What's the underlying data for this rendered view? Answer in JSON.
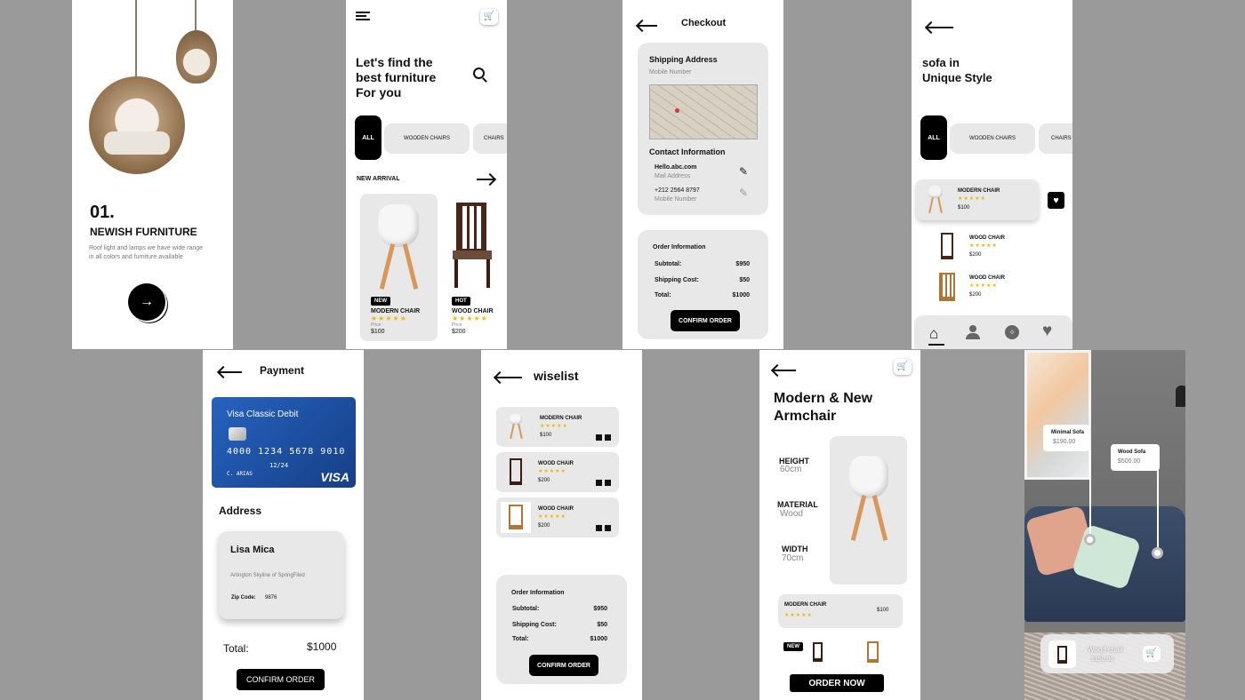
{
  "s1": {
    "num": "01.",
    "title": "NEWISH FURNITURE",
    "desc_line1": "Roof light and lamps we have  wide range",
    "desc_line2": "in all colors and furniture available"
  },
  "s2": {
    "heading_line1": "Let's find the",
    "heading_line2": "best furniture",
    "heading_line3": "For you",
    "tabs": [
      "ALL",
      "WOODEN CHAIRS",
      "CHAIRS"
    ],
    "section": "NEW ARRIVAL",
    "cards": [
      {
        "tag": "NEW",
        "name": "MODERN CHAIR",
        "stars": "★★★★★",
        "price_label": "Price",
        "price": "$100"
      },
      {
        "tag": "HOT",
        "name": "WOOD CHAIR",
        "stars": "★★★★★",
        "price_label": "Price",
        "price": "$200"
      }
    ]
  },
  "s3": {
    "title": "Checkout",
    "ship_title": "Shipping Address",
    "ship_sub": "Mobile Number",
    "contact_title": "Contact Information",
    "email": "Hello.abc.com",
    "email_label": "Mail Address",
    "phone": "+212    2564   8797",
    "phone_label": "Mobile Number",
    "order_title": "Order Information",
    "rows": [
      {
        "k": "Subtotal:",
        "v": "$950"
      },
      {
        "k": "Shipping Cost:",
        "v": "$50"
      },
      {
        "k": "Total:",
        "v": "$1000"
      }
    ],
    "confirm": "CONFIRM ORDER"
  },
  "s4": {
    "heading_line1": "sofa in",
    "heading_line2": "Unique Style",
    "tabs": [
      "ALL",
      "WOODEN CHAIRS",
      "CHAIRS"
    ],
    "items": [
      {
        "name": "MODERN CHAIR",
        "stars": "★★★★★",
        "price": "$100"
      },
      {
        "name": "WOOD CHAIR",
        "stars": "★★★★★",
        "price": "$200"
      },
      {
        "name": "WOOD CHAIR",
        "stars": "★★★★★",
        "price": "$200"
      }
    ]
  },
  "s5": {
    "title": "Payment",
    "card_name": "Visa Classic Debit",
    "card_number": "4000  1234  5678  9010",
    "card_exp": "12/24",
    "card_holder": "C. ARIAS",
    "card_brand": "VISA",
    "address_title": "Address",
    "person": "Lisa Mica",
    "addr": "Artington Skyline of SpringFiled",
    "zip_label": "Zip Code:",
    "zip": "9876",
    "total_label": "Total:",
    "total": "$1000",
    "confirm": "CONFIRM ORDER"
  },
  "s6": {
    "title": "wiselist",
    "items": [
      {
        "name": "MODERN CHAIR",
        "stars": "★★★★★",
        "price": "$100"
      },
      {
        "name": "WOOD CHAIR",
        "stars": "★★★★★",
        "price": "$200"
      },
      {
        "name": "WOOD CHAIR",
        "stars": "★★★★★",
        "price": "$200"
      }
    ],
    "order_title": "Order Information",
    "rows": [
      {
        "k": "Subtotal:",
        "v": "$950"
      },
      {
        "k": "Shipping Cost:",
        "v": "$50"
      },
      {
        "k": "Total:",
        "v": "$1000"
      }
    ],
    "confirm": "CONFIRM ORDER"
  },
  "s7": {
    "heading_line1": "Modern & New",
    "heading_line2": "Armchair",
    "specs": [
      {
        "k": "HEIGHT",
        "v": "60cm"
      },
      {
        "k": "MATERIAL",
        "v": "Wood"
      },
      {
        "k": "WIDTH",
        "v": "70cm"
      }
    ],
    "product": "MODERN CHAIR",
    "stars": "★★★★★",
    "price": "$100",
    "tag": "NEW",
    "order": "ORDER NOW"
  },
  "s8": {
    "label1": "Minimal Sofa",
    "price1": "$190.00",
    "label2": "Wood Sofa",
    "price2": "$500.00",
    "bottom_name": "Wood chair",
    "bottom_price": "$150.00"
  },
  "colors": {
    "accent": "#000000",
    "star": "#f2b705",
    "card_blue": "#1d4fa0",
    "panel": "#e8e8e8",
    "bg": "#9a9a9a"
  }
}
